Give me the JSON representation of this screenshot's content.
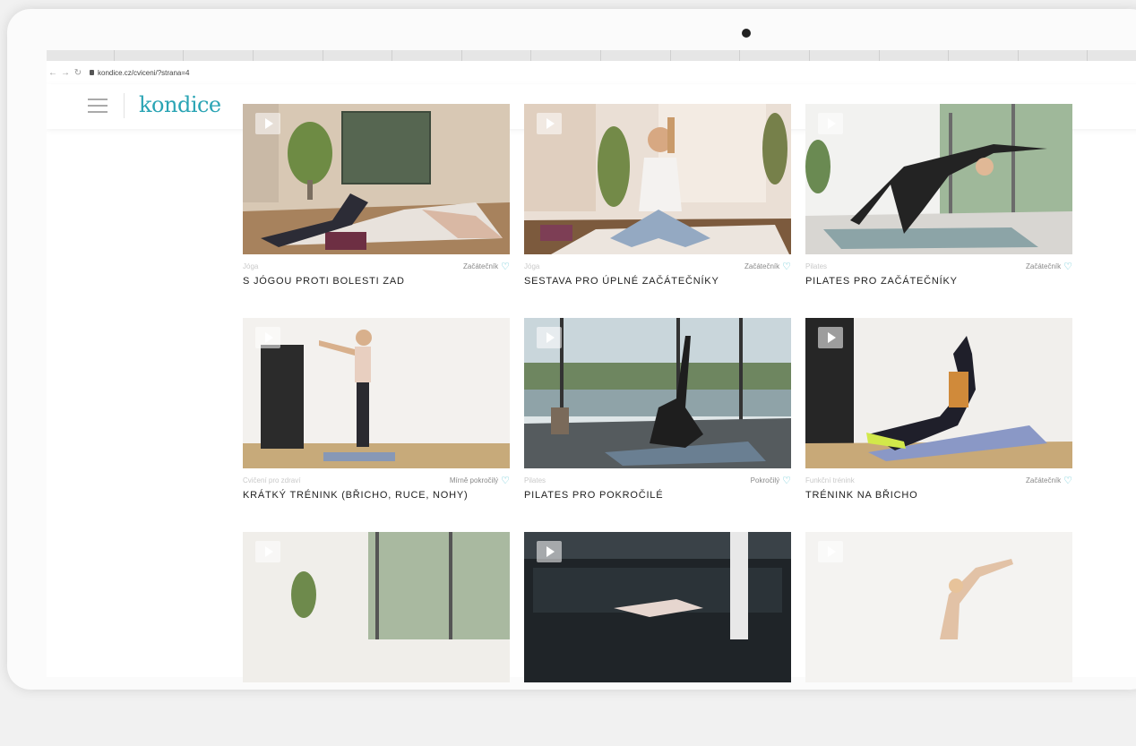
{
  "browser": {
    "url": "kondice.cz/cviceni/?strana=4"
  },
  "site": {
    "logo": "kondice"
  },
  "videos": [
    {
      "category": "Jóga",
      "level": "Začátečník",
      "title": "S JÓGOU PROTI BOLESTI ZAD"
    },
    {
      "category": "Jóga",
      "level": "Začátečník",
      "title": "SESTAVA PRO ÚPLNÉ ZAČÁTEČNÍKY"
    },
    {
      "category": "Pilates",
      "level": "Začátečník",
      "title": "PILATES PRO ZAČÁTEČNÍKY"
    },
    {
      "category": "Cvičení pro zdraví",
      "level": "Mírně pokročilý",
      "title": "KRÁTKÝ TRÉNINK (BŘICHO, RUCE, NOHY)"
    },
    {
      "category": "Pilates",
      "level": "Pokročilý",
      "title": "PILATES PRO POKROČILÉ"
    },
    {
      "category": "Funkční trénink",
      "level": "Začátečník",
      "title": "TRÉNINK NA BŘICHO"
    },
    {
      "category": "",
      "level": "",
      "title": ""
    },
    {
      "category": "",
      "level": "",
      "title": ""
    },
    {
      "category": "",
      "level": "",
      "title": ""
    }
  ],
  "colors": {
    "accent": "#2aa4b4",
    "heart": "#55c0cf"
  }
}
